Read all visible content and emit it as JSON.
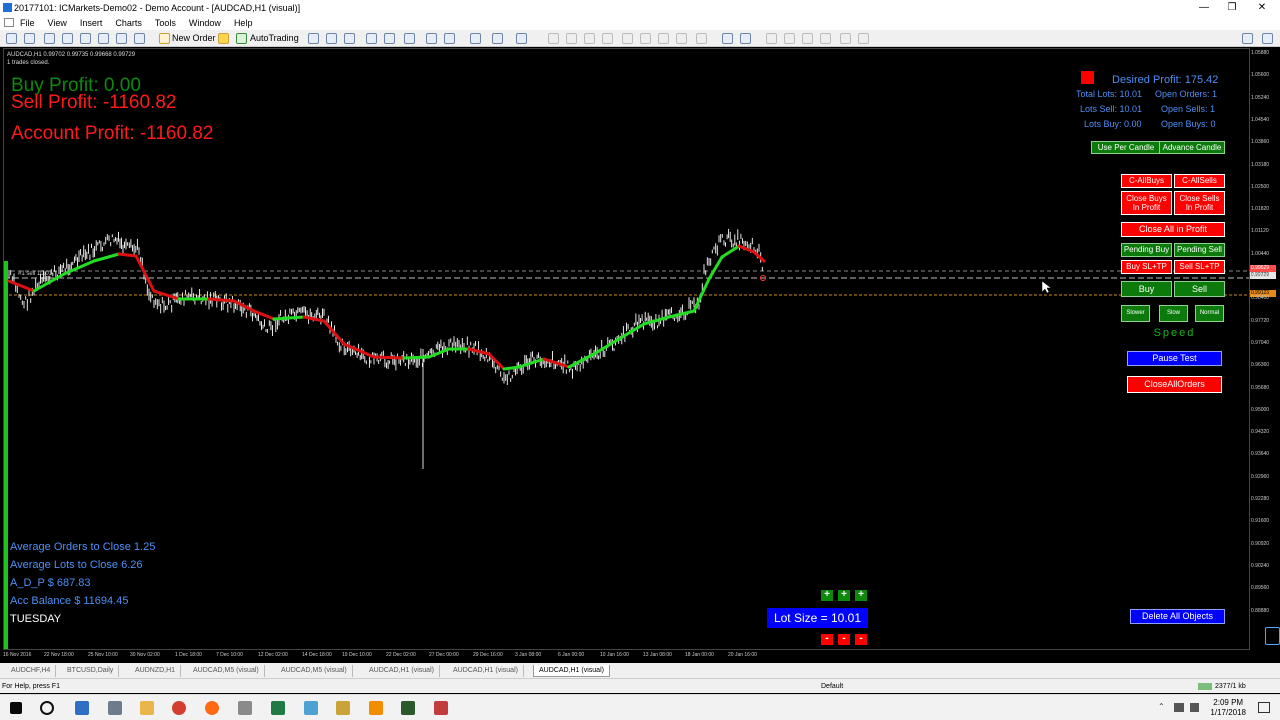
{
  "window": {
    "title": "20177101: ICMarkets-Demo02 - Demo Account - [AUDCAD,H1 (visual)]",
    "controls": [
      "—",
      "❐",
      "✕"
    ]
  },
  "menu": [
    "File",
    "View",
    "Insert",
    "Charts",
    "Tools",
    "Window",
    "Help"
  ],
  "toolbar": {
    "new_order": "New Order",
    "autotrading": "AutoTrading"
  },
  "chart": {
    "symbol_info": "AUDCAD,H1  0.99702 0.99735 0.99668 0.99729",
    "trades_info": "1 trades closed.",
    "buy_profit": "Buy Profit: 0.00",
    "sell_profit": "Sell Profit: -1160.82",
    "account_profit": "Account Profit: -1160.82",
    "avg_orders": "Average Orders to Close  1.25",
    "avg_lots": "Average Lots to Close  6.26",
    "adp": "A_D_P $  687.83",
    "acc_balance": "Acc Balance $  11694.45",
    "day": "TUESDAY",
    "sell_marker": "#1 sell 10.01",
    "colors": {
      "buy_profit": "#0b8a0b",
      "sell_profit": "#ff1a1a",
      "info_blue": "#4d8ff5",
      "ma_up": "#22dd22",
      "ma_down": "#dd1111"
    }
  },
  "panel": {
    "desired_profit": "Desired Profit: 175.42",
    "total_lots": "Total Lots: 10.01",
    "open_orders": "Open Orders: 1",
    "lots_sell": "Lots Sell: 10.01",
    "open_sells": "Open Sells: 1",
    "lots_buy": "Lots Buy: 0.00",
    "open_buys": "Open Buys: 0",
    "use_per_candle": "Use Per Candle",
    "advance_candle": "Advance Candle",
    "c_allbuys": "C-AllBuys",
    "c_allsells": "C-AllSells",
    "close_buys_profit_1": "Close Buys",
    "close_buys_profit_2": "In Profit",
    "close_sells_profit_1": "Close Sells",
    "close_sells_profit_2": "In Profit",
    "close_all_profit": "Close All in Profit",
    "pending_buy": "Pending Buy",
    "pending_sell": "Pending Sell",
    "buy_sltp": "Buy SL+TP",
    "sell_sltp": "Sell SL+TP",
    "buy": "Buy",
    "sell": "Sell",
    "slower": "Slower",
    "slow": "Slow",
    "normal": "Normal",
    "speed": "Speed",
    "pause_test": "Pause Test",
    "close_all_orders": "CloseAllOrders",
    "lot_size": "Lot Size = 10.01",
    "plus": "+",
    "minus": "-",
    "delete_all": "Delete All Objects"
  },
  "price_axis": {
    "ticks": [
      "1.05880",
      "1.05600",
      "1.05240",
      "1.04540",
      "1.03860",
      "1.03180",
      "1.02500",
      "1.01820",
      "1.01120",
      "1.00440",
      "0.99080",
      "0.98400",
      "0.97720",
      "0.97040",
      "0.96360",
      "0.95680",
      "0.95000",
      "0.94320",
      "0.93640",
      "0.92960",
      "0.92280",
      "0.91600",
      "0.90920",
      "0.90240",
      "0.89560",
      "0.88880"
    ],
    "label_a": "0.99529",
    "label_b": "0.99729",
    "label_c": "0.99123"
  },
  "time_axis": [
    "16 Nov 2016",
    "22 Nov 18:00",
    "25 Nov 10:00",
    "30 Nov 02:00",
    "1 Dec 18:00",
    "7 Dec 10:00",
    "12 Dec 02:00",
    "14 Dec 18:00",
    "19 Dec 10:00",
    "22 Dec 02:00",
    "27 Dec 00:00",
    "29 Dec 16:00",
    "3 Jan 08:00",
    "6 Jan 00:00",
    "10 Jan 16:00",
    "13 Jan 08:00",
    "18 Jan 00:00",
    "20 Jan 16:00"
  ],
  "tabs": [
    "AUDCHF,H4",
    "BTCUSD,Daily",
    "AUDNZD,H1",
    "AUDCAD,M5 (visual)",
    "AUDCAD,M5 (visual)",
    "AUDCAD,H1 (visual)",
    "AUDCAD,H1 (visual)",
    "AUDCAD,H1 (visual)"
  ],
  "status": {
    "help": "For Help, press F1",
    "profile": "Default",
    "traffic": "2377/1 kb"
  },
  "taskbar": {
    "time": "2:09 PM",
    "date": "1/17/2018"
  }
}
